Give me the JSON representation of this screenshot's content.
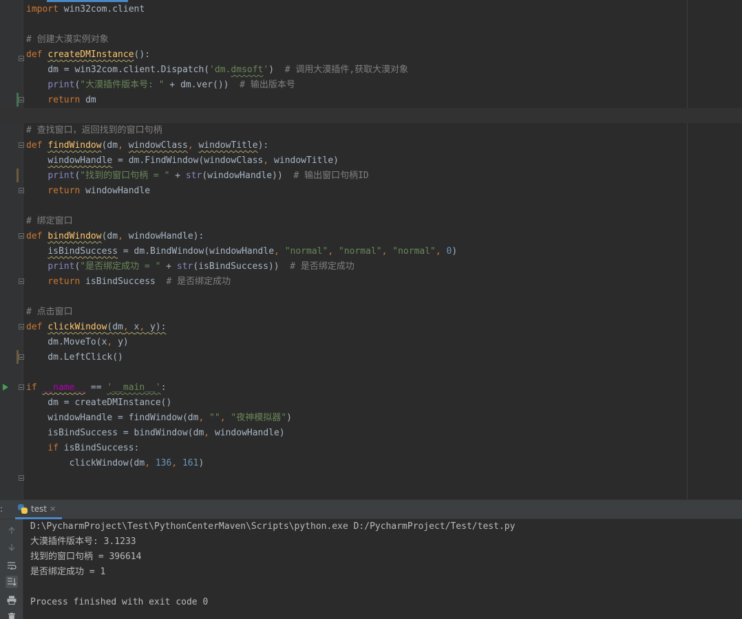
{
  "editor": {
    "lines": [
      [
        {
          "c": "kw",
          "t": "import"
        },
        {
          "c": "plain",
          "t": " win32com.client"
        }
      ],
      [],
      [
        {
          "c": "cm",
          "t": "# 创建大漠实例对象"
        }
      ],
      [
        {
          "c": "kw",
          "t": "def "
        },
        {
          "c": "fn wavy",
          "t": "createDMInstance"
        },
        {
          "c": "plain",
          "t": "():"
        }
      ],
      [
        {
          "c": "plain",
          "t": "    dm = win32com.client.Dispatch("
        },
        {
          "c": "str",
          "t": "'dm."
        },
        {
          "c": "str wavy-g",
          "t": "dmsoft"
        },
        {
          "c": "str",
          "t": "'"
        },
        {
          "c": "plain",
          "t": ")  "
        },
        {
          "c": "cm",
          "t": "# 调用大漠插件,获取大漠对象"
        }
      ],
      [
        {
          "c": "plain",
          "t": "    "
        },
        {
          "c": "bi",
          "t": "print"
        },
        {
          "c": "plain",
          "t": "("
        },
        {
          "c": "str",
          "t": "\"大漠插件版本号: \""
        },
        {
          "c": "plain",
          "t": " + dm.ver())  "
        },
        {
          "c": "cm",
          "t": "# 输出版本号"
        }
      ],
      [
        {
          "c": "plain",
          "t": "    "
        },
        {
          "c": "kw",
          "t": "return"
        },
        {
          "c": "plain",
          "t": " dm"
        }
      ],
      [],
      [
        {
          "c": "cm",
          "t": "# 查找窗口，返回找到的窗口句柄"
        }
      ],
      [
        {
          "c": "kw",
          "t": "def "
        },
        {
          "c": "fn wavy",
          "t": "findWindow"
        },
        {
          "c": "plain",
          "t": "(dm"
        },
        {
          "c": "kw",
          "t": ", "
        },
        {
          "c": "plain wavy",
          "t": "windowClass"
        },
        {
          "c": "kw",
          "t": ", "
        },
        {
          "c": "plain wavy",
          "t": "windowTitle"
        },
        {
          "c": "plain",
          "t": "):"
        }
      ],
      [
        {
          "c": "plain",
          "t": "    "
        },
        {
          "c": "plain wavy",
          "t": "windowHandle"
        },
        {
          "c": "plain",
          "t": " = dm.FindWindow(windowClass"
        },
        {
          "c": "kw",
          "t": ", "
        },
        {
          "c": "plain",
          "t": "windowTitle)"
        }
      ],
      [
        {
          "c": "plain",
          "t": "    "
        },
        {
          "c": "bi",
          "t": "print"
        },
        {
          "c": "plain",
          "t": "("
        },
        {
          "c": "str",
          "t": "\"找到的窗口句柄 = \""
        },
        {
          "c": "plain",
          "t": " + "
        },
        {
          "c": "bi",
          "t": "str"
        },
        {
          "c": "plain",
          "t": "(windowHandle))  "
        },
        {
          "c": "cm",
          "t": "# 输出窗口句柄ID"
        }
      ],
      [
        {
          "c": "plain",
          "t": "    "
        },
        {
          "c": "kw",
          "t": "return"
        },
        {
          "c": "plain",
          "t": " windowHandle"
        }
      ],
      [],
      [
        {
          "c": "cm",
          "t": "# 绑定窗口"
        }
      ],
      [
        {
          "c": "kw",
          "t": "def "
        },
        {
          "c": "fn wavy",
          "t": "bindWindow"
        },
        {
          "c": "plain",
          "t": "(dm"
        },
        {
          "c": "kw",
          "t": ", "
        },
        {
          "c": "plain",
          "t": "windowHandle):"
        }
      ],
      [
        {
          "c": "plain",
          "t": "    "
        },
        {
          "c": "plain wavy",
          "t": "isBindSuccess"
        },
        {
          "c": "plain",
          "t": " = dm.BindWindow(windowHandle"
        },
        {
          "c": "kw",
          "t": ", "
        },
        {
          "c": "str",
          "t": "\"normal\""
        },
        {
          "c": "kw",
          "t": ", "
        },
        {
          "c": "str",
          "t": "\"normal\""
        },
        {
          "c": "kw",
          "t": ", "
        },
        {
          "c": "str",
          "t": "\"normal\""
        },
        {
          "c": "kw",
          "t": ", "
        },
        {
          "c": "num",
          "t": "0"
        },
        {
          "c": "plain",
          "t": ")"
        }
      ],
      [
        {
          "c": "plain",
          "t": "    "
        },
        {
          "c": "bi",
          "t": "print"
        },
        {
          "c": "plain",
          "t": "("
        },
        {
          "c": "str",
          "t": "\"是否绑定成功 = \""
        },
        {
          "c": "plain",
          "t": " + "
        },
        {
          "c": "bi",
          "t": "str"
        },
        {
          "c": "plain",
          "t": "(isBindSuccess))  "
        },
        {
          "c": "cm",
          "t": "# 是否绑定成功"
        }
      ],
      [
        {
          "c": "plain",
          "t": "    "
        },
        {
          "c": "kw",
          "t": "return"
        },
        {
          "c": "plain",
          "t": " isBindSuccess  "
        },
        {
          "c": "cm",
          "t": "# 是否绑定成功"
        }
      ],
      [],
      [
        {
          "c": "cm",
          "t": "# 点击窗口"
        }
      ],
      [
        {
          "c": "kw",
          "t": "def "
        },
        {
          "c": "fn wavy",
          "t": "clickWindow"
        },
        {
          "c": "plain wavy",
          "t": "(dm"
        },
        {
          "c": "kw wavy",
          "t": ", "
        },
        {
          "c": "plain wavy",
          "t": "x"
        },
        {
          "c": "kw wavy",
          "t": ", "
        },
        {
          "c": "plain wavy",
          "t": "y):"
        }
      ],
      [
        {
          "c": "plain",
          "t": "    dm.MoveTo(x"
        },
        {
          "c": "kw",
          "t": ", "
        },
        {
          "c": "plain",
          "t": "y)"
        }
      ],
      [
        {
          "c": "plain",
          "t": "    dm.LeftClick()"
        }
      ],
      [],
      [
        {
          "c": "kw",
          "t": "if "
        },
        {
          "c": "mg wavy",
          "t": "__name__"
        },
        {
          "c": "plain",
          "t": " == "
        },
        {
          "c": "str wavy-g",
          "t": "'__main__'"
        },
        {
          "c": "plain",
          "t": ":"
        }
      ],
      [
        {
          "c": "plain",
          "t": "    dm = createDMInstance()"
        }
      ],
      [
        {
          "c": "plain",
          "t": "    windowHandle = findWindow(dm"
        },
        {
          "c": "kw",
          "t": ", "
        },
        {
          "c": "str",
          "t": "\"\""
        },
        {
          "c": "kw",
          "t": ", "
        },
        {
          "c": "str",
          "t": "\"夜神模拟器\""
        },
        {
          "c": "plain",
          "t": ")"
        }
      ],
      [
        {
          "c": "plain",
          "t": "    isBindSuccess = bindWindow(dm"
        },
        {
          "c": "kw",
          "t": ", "
        },
        {
          "c": "plain",
          "t": "windowHandle)"
        }
      ],
      [
        {
          "c": "plain",
          "t": "    "
        },
        {
          "c": "kw",
          "t": "if"
        },
        {
          "c": "plain",
          "t": " isBindSuccess:"
        }
      ],
      [
        {
          "c": "plain",
          "t": "        clickWindow(dm"
        },
        {
          "c": "kw",
          "t": ", "
        },
        {
          "c": "num",
          "t": "136"
        },
        {
          "c": "kw",
          "t": ", "
        },
        {
          "c": "num",
          "t": "161"
        },
        {
          "c": "plain",
          "t": ")"
        }
      ]
    ]
  },
  "run_panel": {
    "prefix": ":",
    "tab_label": "test",
    "tab_close": "×",
    "console_lines": [
      "D:\\PycharmProject\\Test\\PythonCenterMaven\\Scripts\\python.exe D:/PycharmProject/Test/test.py",
      "大漠插件版本号: 3.1233",
      "找到的窗口句柄 = 396614",
      "是否绑定成功 = 1",
      "",
      "Process finished with exit code 0"
    ]
  },
  "icons": {
    "run_gutter": "run-arrow-icon",
    "scroll_up": "arrow-up-icon",
    "scroll_down": "arrow-down-icon",
    "soft_wrap": "soft-wrap-icon",
    "scroll_to_end": "scroll-to-end-icon",
    "print": "print-icon",
    "delete": "trash-icon"
  },
  "colors": {
    "keyword": "#cc7832",
    "function": "#ffc66d",
    "string": "#6a8759",
    "number": "#6897bb",
    "comment": "#808080",
    "builtin": "#8888c6",
    "accent": "#4a88c7"
  }
}
